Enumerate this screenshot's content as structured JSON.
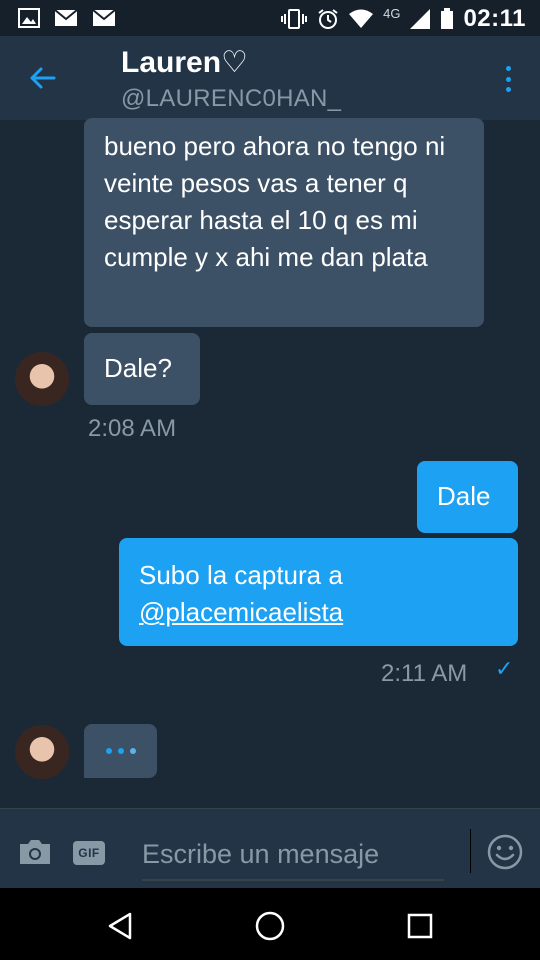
{
  "status_bar": {
    "time": "02:11",
    "network": "4G"
  },
  "header": {
    "name": "Lauren♡",
    "handle": "@LAURENC0HAN_"
  },
  "messages": {
    "m1": {
      "text": "bueno pero ahora no tengo ni veinte pesos vas a tener q esperar hasta el 10 q es mi cumple y x ahi me dan plata"
    },
    "m2": {
      "text": "Dale?"
    },
    "m2_time": "2:08 AM",
    "m3": {
      "text": "Dale"
    },
    "m4": {
      "text": "Subo la captura a ",
      "mention": "@placemicaelista"
    },
    "m4_time": "2:11 AM",
    "read_mark": "✓"
  },
  "composer": {
    "placeholder": "Escribe un mensaje",
    "gif_label": "GIF"
  },
  "icons": {
    "back": "arrow-left-icon",
    "more": "more-vertical-icon",
    "camera": "camera-icon",
    "emoji": "smiley-icon"
  },
  "colors": {
    "accent": "#1da1f2",
    "background": "#1b2836",
    "header": "#243447",
    "incoming_bubble": "#3d5166"
  }
}
